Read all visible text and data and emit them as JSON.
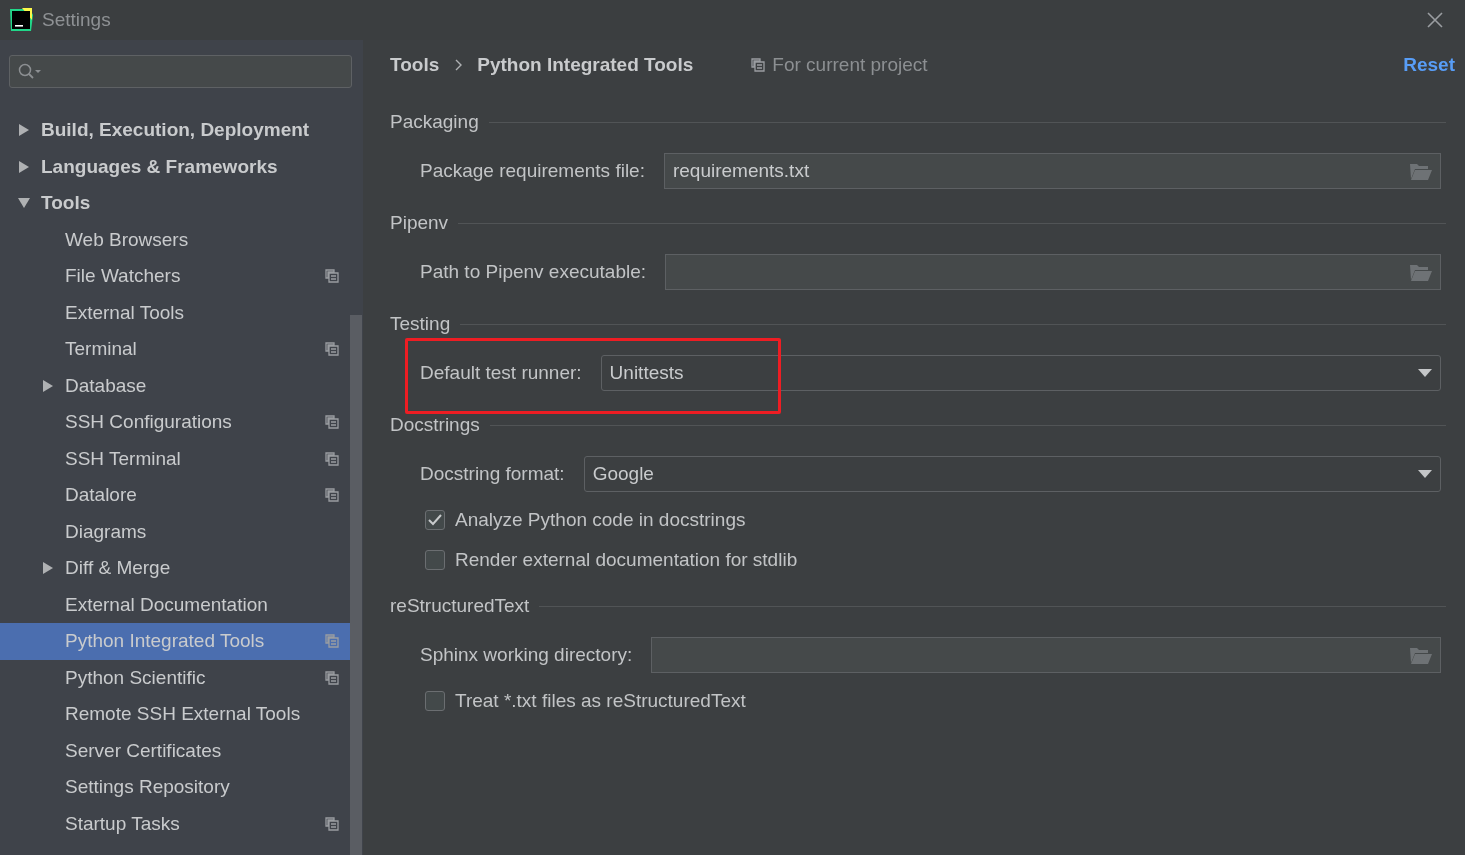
{
  "window": {
    "title": "Settings"
  },
  "sidebar": {
    "items": [
      {
        "label": "Build, Execution, Deployment",
        "expanded": false,
        "selected": false
      },
      {
        "label": "Languages & Frameworks",
        "expanded": false,
        "selected": false
      },
      {
        "label": "Tools",
        "expanded": true,
        "selected": false,
        "children": [
          {
            "label": "Web Browsers",
            "project_scope": false,
            "selected": false
          },
          {
            "label": "File Watchers",
            "project_scope": true,
            "selected": false
          },
          {
            "label": "External Tools",
            "project_scope": false,
            "selected": false
          },
          {
            "label": "Terminal",
            "project_scope": true,
            "selected": false
          },
          {
            "label": "Database",
            "expanded": false,
            "project_scope": false,
            "selected": false
          },
          {
            "label": "SSH Configurations",
            "project_scope": true,
            "selected": false
          },
          {
            "label": "SSH Terminal",
            "project_scope": true,
            "selected": false
          },
          {
            "label": "Datalore",
            "project_scope": true,
            "selected": false
          },
          {
            "label": "Diagrams",
            "project_scope": false,
            "selected": false
          },
          {
            "label": "Diff & Merge",
            "expanded": false,
            "project_scope": false,
            "selected": false
          },
          {
            "label": "External Documentation",
            "project_scope": false,
            "selected": false
          },
          {
            "label": "Python Integrated Tools",
            "project_scope": true,
            "selected": true
          },
          {
            "label": "Python Scientific",
            "project_scope": true,
            "selected": false
          },
          {
            "label": "Remote SSH External Tools",
            "project_scope": false,
            "selected": false
          },
          {
            "label": "Server Certificates",
            "project_scope": false,
            "selected": false
          },
          {
            "label": "Settings Repository",
            "project_scope": false,
            "selected": false
          },
          {
            "label": "Startup Tasks",
            "project_scope": true,
            "selected": false
          }
        ]
      }
    ]
  },
  "header": {
    "breadcrumb": [
      "Tools",
      "Python Integrated Tools"
    ],
    "scope": "For current project",
    "reset": "Reset"
  },
  "sections": [
    {
      "title": "Packaging",
      "rows": [
        {
          "kind": "path",
          "label": "Package requirements file:",
          "value": "requirements.txt",
          "highlighted": false
        }
      ]
    },
    {
      "title": "Pipenv",
      "rows": [
        {
          "kind": "path",
          "label": "Path to Pipenv executable:",
          "highlighted": false
        }
      ]
    },
    {
      "title": "Testing",
      "rows": [
        {
          "kind": "dropdown",
          "label": "Default test runner:",
          "value": "Unittests",
          "highlighted": true
        }
      ]
    },
    {
      "title": "Docstrings",
      "rows": [
        {
          "kind": "dropdown",
          "label": "Docstring format:",
          "value": "Google",
          "highlighted": false
        },
        {
          "kind": "checkbox",
          "label": "Analyze Python code in docstrings",
          "checked": true
        },
        {
          "kind": "checkbox",
          "label": "Render external documentation for stdlib",
          "checked": false
        }
      ]
    },
    {
      "title": "reStructuredText",
      "rows": [
        {
          "kind": "path",
          "label": "Sphinx working directory:",
          "highlighted": false
        },
        {
          "kind": "checkbox",
          "label": "Treat *.txt files as reStructuredText",
          "checked": false
        }
      ]
    }
  ]
}
